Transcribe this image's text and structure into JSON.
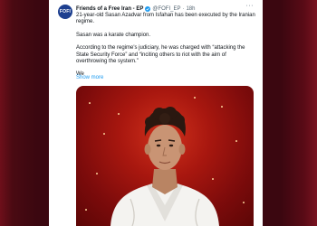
{
  "tweet": {
    "avatar_text": "FOFI",
    "display_name": "Friends of a Free Iran - EP",
    "handle": "@FOFI_EP",
    "time": "18h",
    "more_label": "···",
    "paragraphs": [
      "21-year-old Sasan Azadvar from Isfahan has been executed by the Iranian regime.",
      "Sasan was a karate champion.",
      "According to the regime's judiciary, he was charged with “attacking the State Security Force” and “inciting others to riot with the aim of overthrowing the system.”",
      "We"
    ],
    "show_more": "Show more"
  },
  "colors": {
    "verified": "#1d9bf0",
    "link": "#1d9bf0",
    "text": "#0f1419",
    "muted": "#536471",
    "avatar_bg": "#1d3f8f"
  },
  "icons": {
    "verified": "verified-badge-icon",
    "more": "more-options-icon"
  }
}
